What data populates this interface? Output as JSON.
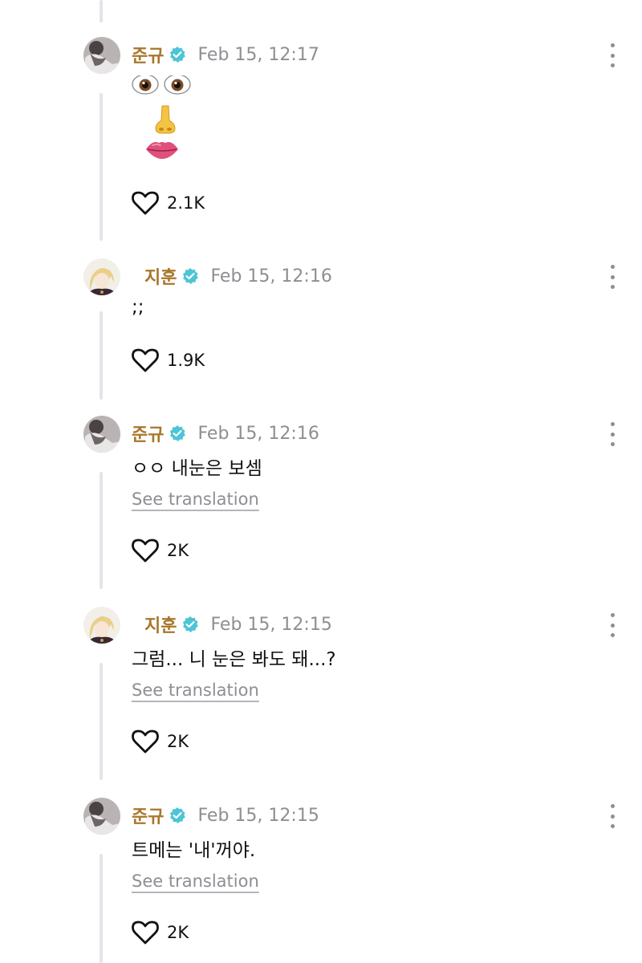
{
  "posts": [
    {
      "username": "준규",
      "timestamp": "Feb 15, 12:17",
      "likes": "2.1K",
      "content_icons": [
        "eyes-emoji",
        "nose-emoji",
        "lips-emoji"
      ]
    },
    {
      "username": "지훈",
      "timestamp": "Feb 15, 12:16",
      "text": ";;",
      "likes": "1.9K"
    },
    {
      "username": "준규",
      "timestamp": "Feb 15, 12:16",
      "text": "ㅇㅇ 내눈은 보셈",
      "translation_label": "See translation",
      "likes": "2K"
    },
    {
      "username": "지훈",
      "timestamp": "Feb 15, 12:15",
      "text": "그럼... 니 눈은 봐도 돼...?",
      "translation_label": "See translation",
      "likes": "2K"
    },
    {
      "username": "준규",
      "timestamp": "Feb 15, 12:15",
      "text": "트메는 '내'꺼야.",
      "translation_label": "See translation",
      "likes": "2K"
    }
  ],
  "colors": {
    "username": "#a8772b",
    "verified": "#4cc5d6",
    "muted": "#8e8e93",
    "thread_line": "#e4e4ea"
  }
}
